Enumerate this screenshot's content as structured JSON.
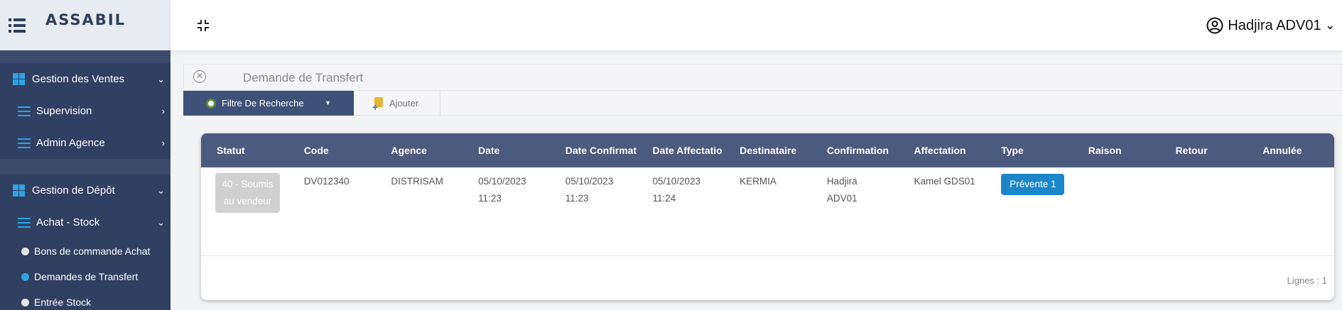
{
  "brand": {
    "logo": "ASSABIL"
  },
  "user": {
    "name": "Hadjira ADV01"
  },
  "sidebar": {
    "items": [
      {
        "label": "Gestion des Ventes",
        "chevron": "⌄"
      },
      {
        "label": "Supervision",
        "chevron": "›"
      },
      {
        "label": "Admin Agence",
        "chevron": "›"
      },
      {
        "label": "Gestion de Dépôt",
        "chevron": "⌄"
      },
      {
        "label": "Achat - Stock",
        "chevron": "⌄"
      }
    ],
    "subitems": [
      {
        "label": "Bons de commande Achat"
      },
      {
        "label": "Demandes de Transfert"
      },
      {
        "label": "Entrée Stock"
      }
    ]
  },
  "panel": {
    "title": "Demande de Transfert"
  },
  "toolbar": {
    "filter_label": "Filtre De Recherche",
    "add_label": "Ajouter"
  },
  "table": {
    "columns": [
      "Statut",
      "Code",
      "Agence",
      "Date",
      "Date Confirmat",
      "Date Affectatio",
      "Destinataire",
      "Confirmation",
      "Affectation",
      "Type",
      "Raison",
      "Retour",
      "Annulée"
    ],
    "row": {
      "statut": "40 - Soumis au vendeur",
      "code": "DV012340",
      "agence": "DISTRISAM",
      "date": "05/10/2023 11:23",
      "date_confirmation": "05/10/2023 11:23",
      "date_affectation": "05/10/2023 11:24",
      "destinataire": "KERMIA",
      "confirmation": "Hadjira ADV01",
      "affectation": "Kamel GDS01",
      "type": "Prévente 1",
      "raison": "",
      "retour": "",
      "annulee": ""
    },
    "footer": "Lignes : 1"
  },
  "colors": {
    "sidebar": "#3a4a68",
    "accent": "#2da3e6",
    "header": "#4a5b7d",
    "badge": "#1b85c9"
  }
}
